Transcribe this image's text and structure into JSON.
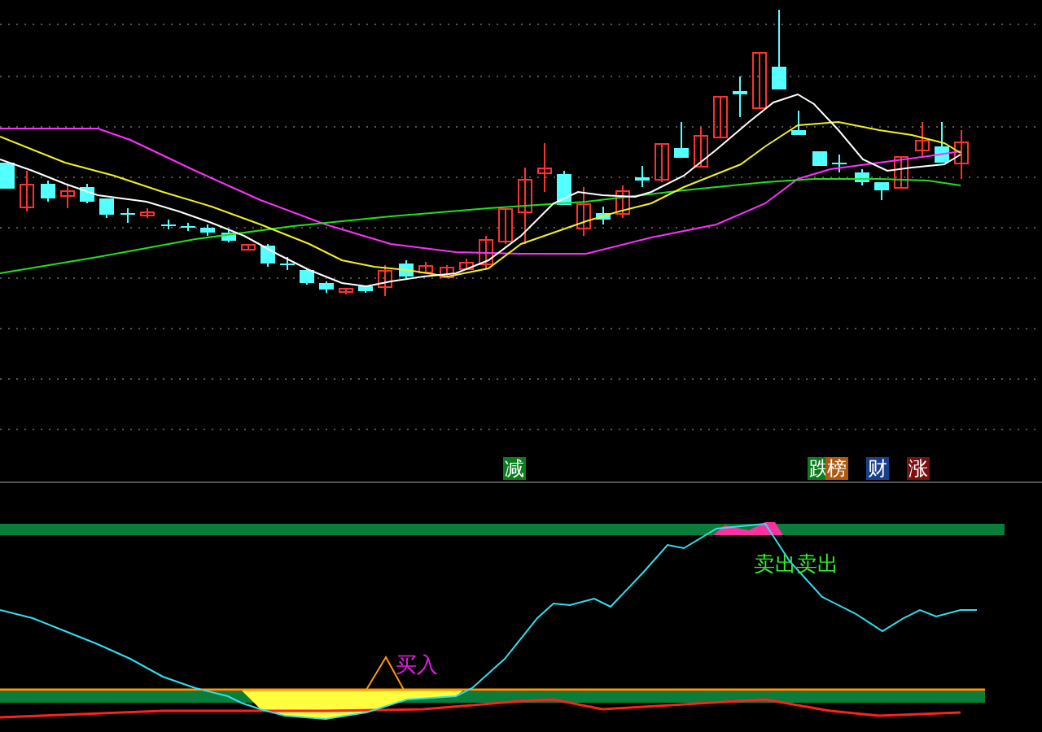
{
  "tags": [
    {
      "text": "减",
      "color": "#0b7d1e"
    },
    {
      "text": "跌",
      "color": "#0b7d1e"
    },
    {
      "text": "榜",
      "color": "#b05a10"
    },
    {
      "text": "财",
      "color": "#1a3f8a"
    },
    {
      "text": "涨",
      "color": "#7a1010"
    }
  ],
  "signals": [
    {
      "text": "买入",
      "kind": "buy"
    },
    {
      "text": "卖出卖出",
      "kind": "sell"
    }
  ]
}
